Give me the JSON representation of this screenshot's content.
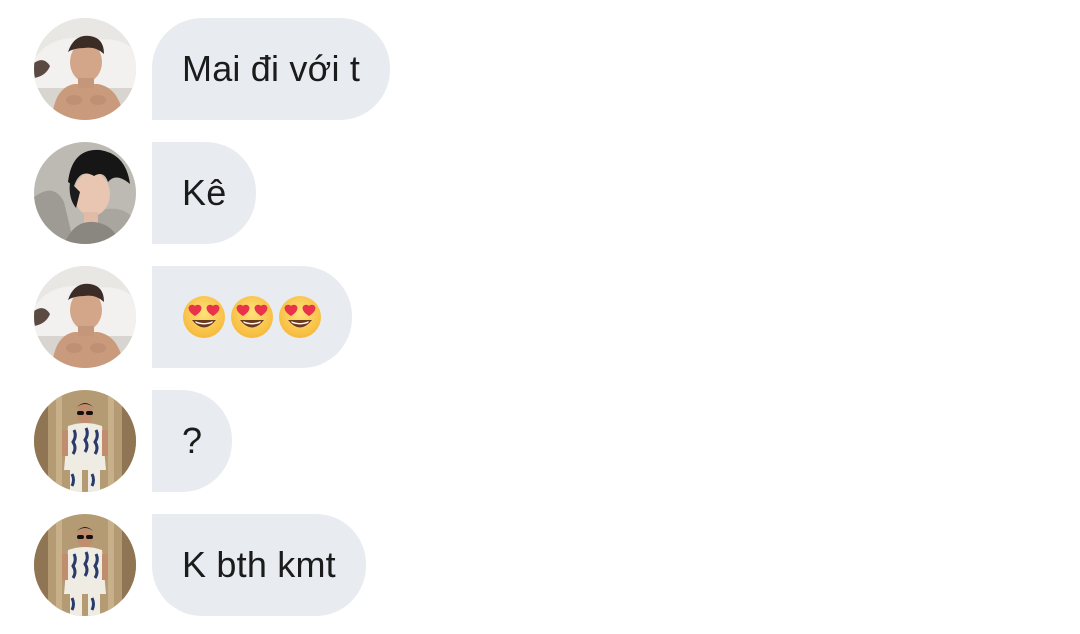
{
  "messages": [
    {
      "avatar": "avatar-sleeping-man",
      "text": "Mai đi với t"
    },
    {
      "avatar": "avatar-dark-hair-man",
      "text": "Kê"
    },
    {
      "avatar": "avatar-sleeping-man",
      "text": "",
      "emojis": [
        "heart-eyes-emoji",
        "heart-eyes-emoji",
        "heart-eyes-emoji"
      ]
    },
    {
      "avatar": "avatar-sunglasses-man",
      "text": "?"
    },
    {
      "avatar": "avatar-sunglasses-man",
      "text": "K bth kmt"
    }
  ],
  "colors": {
    "bubble_bg": "#e8ecf0",
    "text": "#1b1b1b",
    "background": "#ffffff"
  }
}
